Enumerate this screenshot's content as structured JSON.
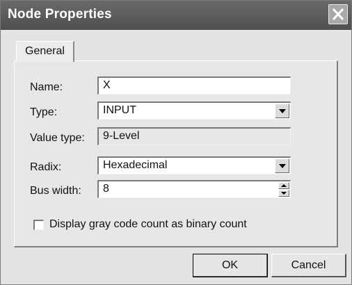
{
  "window": {
    "title": "Node Properties"
  },
  "tabs": [
    {
      "label": "General"
    }
  ],
  "form": {
    "name": {
      "label": "Name:",
      "value": "X"
    },
    "type": {
      "label": "Type:",
      "value": "INPUT"
    },
    "value_type": {
      "label": "Value type:",
      "value": "9-Level"
    },
    "radix": {
      "label": "Radix:",
      "value": "Hexadecimal"
    },
    "bus_width": {
      "label": "Bus width:",
      "value": "8"
    },
    "gray_code": {
      "label": "Display gray code count as binary count",
      "checked": false
    }
  },
  "buttons": {
    "ok": "OK",
    "cancel": "Cancel"
  },
  "icons": {
    "close": "close-icon",
    "dropdown": "chevron-down-icon",
    "spin_up": "spin-up-icon",
    "spin_down": "spin-down-icon"
  }
}
